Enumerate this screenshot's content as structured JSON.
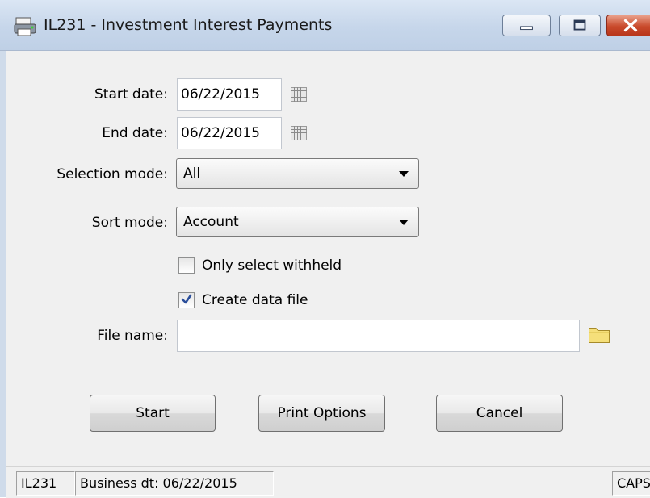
{
  "window": {
    "title": "IL231 - Investment Interest Payments",
    "app_icon": "printer-icon"
  },
  "form": {
    "start_date_label": "Start date:",
    "start_date_value": "06/22/2015",
    "end_date_label": "End date:",
    "end_date_value": "06/22/2015",
    "selection_mode_label": "Selection mode:",
    "selection_mode_value": "All",
    "sort_mode_label": "Sort mode:",
    "sort_mode_value": "Account",
    "only_select_withheld_label": "Only select withheld",
    "only_select_withheld_checked": false,
    "create_data_file_label": "Create data file",
    "create_data_file_checked": true,
    "file_name_label": "File name:",
    "file_name_value": ""
  },
  "buttons": {
    "start": "Start",
    "print_options": "Print Options",
    "cancel": "Cancel"
  },
  "status": {
    "program": "IL231",
    "business_date": "Business dt: 06/22/2015",
    "caps": "CAPS"
  },
  "colors": {
    "title_bar": "#c6d6ea",
    "close_button": "#c94a2c",
    "checkmark": "#2a4e9a"
  }
}
